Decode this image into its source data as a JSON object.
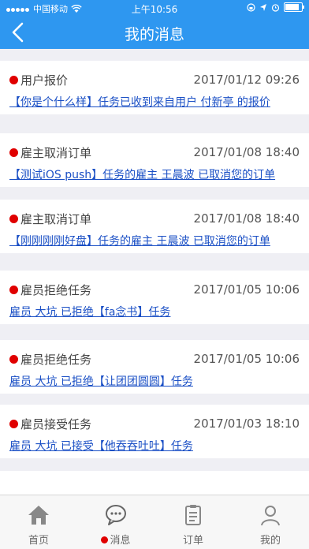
{
  "status_bar": {
    "carrier": "中国移动",
    "time": "上午10:56",
    "icons": [
      "signal-dots-icon",
      "wifi-icon",
      "location-icon",
      "alarm-icon",
      "battery-icon"
    ]
  },
  "nav": {
    "title": "我的消息",
    "back_icon": "chevron-left-icon"
  },
  "messages": [
    {
      "type": "用户报价",
      "time": "2017/01/12 09:26",
      "text": "【你是个什么样】任务已收到来自用户 付新亭 的报价",
      "unread": true
    },
    {
      "type": "雇主取消订单",
      "time": "2017/01/08 18:40",
      "text": "【测试iOS push】任务的雇主 王晨波 已取消您的订单",
      "unread": true
    },
    {
      "type": "雇主取消订单",
      "time": "2017/01/08 18:40",
      "text": "【刚刚刚刚好盘】任务的雇主 王晨波 已取消您的订单",
      "unread": true
    },
    {
      "type": "雇员拒绝任务",
      "time": "2017/01/05 10:06",
      "text": "雇员 大坑 已拒绝【fa念书】任务",
      "unread": true
    },
    {
      "type": "雇员拒绝任务",
      "time": "2017/01/05 10:06",
      "text": "雇员 大坑 已拒绝【让团团圆圆】任务",
      "unread": true
    },
    {
      "type": "雇员接受任务",
      "time": "2017/01/03 18:10",
      "text": "雇员 大坑 已接受【他吞吞吐吐】任务",
      "unread": true
    }
  ],
  "tabs": [
    {
      "label": "首页",
      "icon": "home-icon"
    },
    {
      "label": "消息",
      "icon": "chat-bubble-icon",
      "badge": true,
      "active": true
    },
    {
      "label": "订单",
      "icon": "clipboard-icon"
    },
    {
      "label": "我的",
      "icon": "person-icon"
    }
  ],
  "colors": {
    "primary": "#2e97f0",
    "unread_dot": "#e00000",
    "link": "#1a4fc5"
  }
}
